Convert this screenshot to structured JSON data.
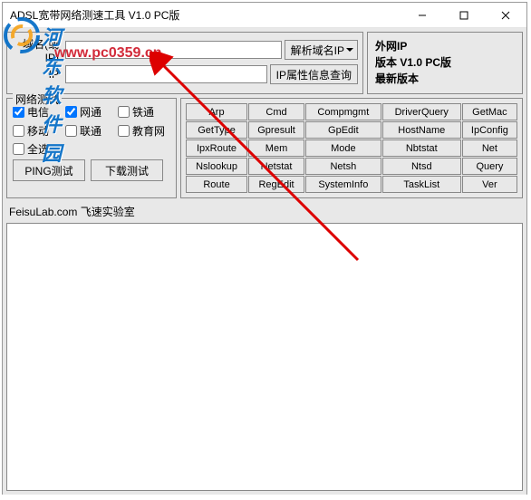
{
  "window": {
    "title": "ADSL宽带网络测速工具 V1.0 PC版"
  },
  "urlPanel": {
    "label1": "域名(或IP)",
    "label2": "IP",
    "input1": "",
    "input2": "",
    "btn1": "解析域名IP",
    "btn2": "IP属性信息查询"
  },
  "ipPanel": {
    "l1a": "外网IP",
    "l2a": "版本",
    "l2b": "V1.0 PC版",
    "l3a": "最新版本"
  },
  "netTest": {
    "legend": "网络测试",
    "checks": [
      {
        "label": "电信",
        "checked": true
      },
      {
        "label": "网通",
        "checked": true
      },
      {
        "label": "铁通",
        "checked": false
      },
      {
        "label": "移动",
        "checked": false
      },
      {
        "label": "联通",
        "checked": false
      },
      {
        "label": "教育网",
        "checked": false
      }
    ],
    "selectAll": "全选",
    "btnPing": "PING测试",
    "btnDown": "下载测试"
  },
  "cmds": [
    [
      "Arp",
      "Cmd",
      "Compmgmt",
      "DriverQuery",
      "GetMac"
    ],
    [
      "GetType",
      "Gpresult",
      "GpEdit",
      "HostName",
      "IpConfig"
    ],
    [
      "IpxRoute",
      "Mem",
      "Mode",
      "Nbtstat",
      "Net"
    ],
    [
      "Nslookup",
      "Netstat",
      "Netsh",
      "Ntsd",
      "Query"
    ],
    [
      "Route",
      "RegEdit",
      "SystemInfo",
      "TaskList",
      "Ver"
    ]
  ],
  "footer": "FeisuLab.com 飞速实验室",
  "watermark": {
    "text": "河东软件园",
    "url": "www.pc0359.cn"
  }
}
